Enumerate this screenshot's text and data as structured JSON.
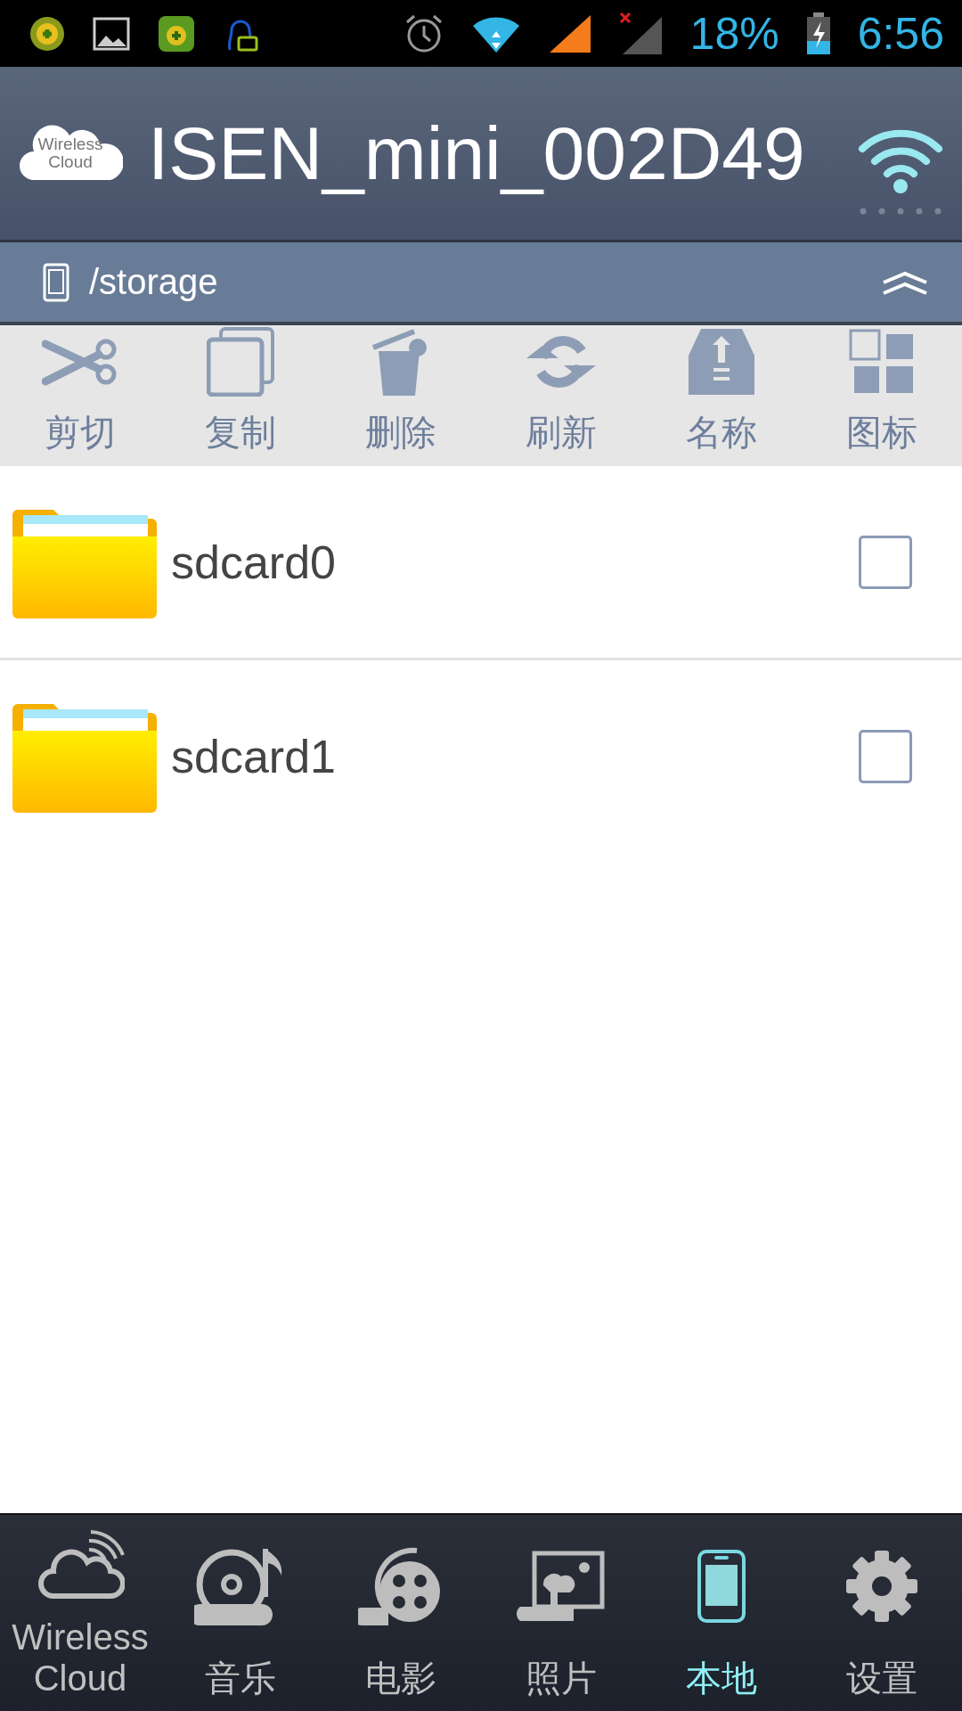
{
  "status_bar": {
    "battery": "18%",
    "time": "6:56"
  },
  "header": {
    "logo": "Wireless Cloud",
    "title": "ISEN_mini_002D49"
  },
  "path_bar": {
    "path": "/storage"
  },
  "toolbar": [
    {
      "label": "剪切",
      "kind": "scissors"
    },
    {
      "label": "复制",
      "kind": "copy"
    },
    {
      "label": "删除",
      "kind": "trash"
    },
    {
      "label": "刷新",
      "kind": "refresh"
    },
    {
      "label": "名称",
      "kind": "tray"
    },
    {
      "label": "图标",
      "kind": "grid"
    }
  ],
  "files": [
    {
      "name": "sdcard0",
      "checked": false
    },
    {
      "name": "sdcard1",
      "checked": false
    }
  ],
  "bottom_nav": [
    {
      "label": "Wireless Cloud",
      "kind": "cloud",
      "selected": false
    },
    {
      "label": "音乐",
      "kind": "music",
      "selected": false
    },
    {
      "label": "电影",
      "kind": "film",
      "selected": false
    },
    {
      "label": "照片",
      "kind": "photo",
      "selected": false
    },
    {
      "label": "本地",
      "kind": "phone",
      "selected": true
    },
    {
      "label": "设置",
      "kind": "gear",
      "selected": false
    }
  ]
}
